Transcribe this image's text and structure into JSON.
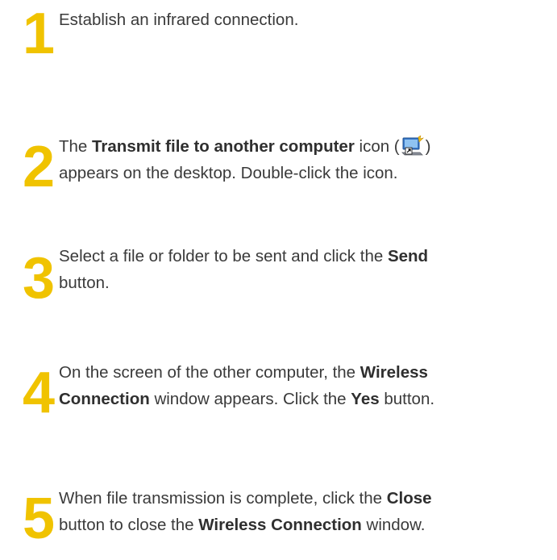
{
  "accent_color": "#f0c300",
  "steps": [
    {
      "number": "1",
      "parts": [
        "Establish an infrared connection."
      ]
    },
    {
      "number": "2",
      "parts": [
        "The ",
        "Transmit file to another computer",
        " icon (",
        ")",
        "appears on the desktop. Double-click the icon."
      ],
      "icon": "transmit-file-computer-icon"
    },
    {
      "number": "3",
      "parts": [
        "Select a file or folder to be sent and click the ",
        "Send",
        "button."
      ]
    },
    {
      "number": "4",
      "parts": [
        "On the screen of the other computer, the ",
        "Wireless",
        "Connection",
        " window appears. Click the ",
        "Yes",
        " button."
      ]
    },
    {
      "number": "5",
      "parts": [
        "When file transmission is complete, click the ",
        "Close",
        "button to close the ",
        "Wireless Connection",
        " window."
      ]
    }
  ]
}
